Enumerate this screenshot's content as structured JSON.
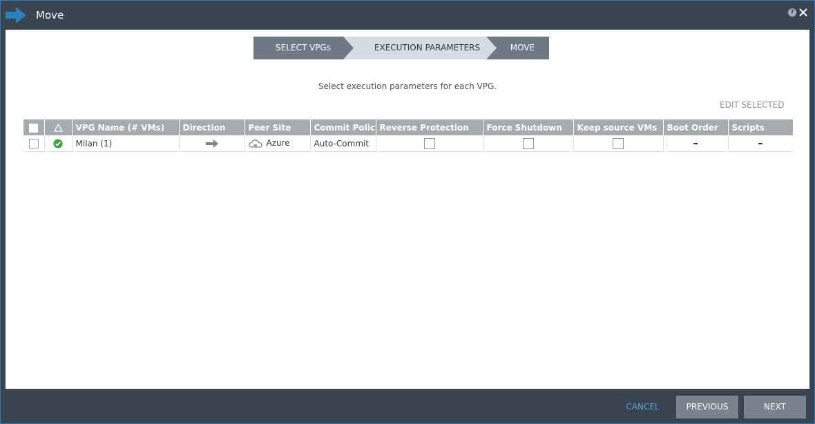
{
  "window": {
    "title": "Move",
    "icons": {
      "app": "move-arrow-icon",
      "help": "help-icon",
      "close": "close-icon"
    },
    "help_glyph": "?"
  },
  "wizard": {
    "steps": [
      {
        "label": "SELECT VPGs",
        "state": "done"
      },
      {
        "label": "EXECUTION PARAMETERS",
        "state": "active"
      },
      {
        "label": "MOVE",
        "state": "pending"
      }
    ]
  },
  "instruction": "Select execution parameters for each VPG.",
  "edit_selected_label": "EDIT SELECTED",
  "table": {
    "headers": {
      "select": "",
      "alert": "alert-triangle-icon",
      "vpg_name": "VPG Name (# VMs)",
      "direction": "Direction",
      "peer_site": "Peer Site",
      "commit_policy": "Commit Policy",
      "reverse_protection": "Reverse Protection",
      "force_shutdown": "Force Shutdown",
      "keep_source_vms": "Keep source VMs",
      "boot_order": "Boot Order",
      "scripts": "Scripts"
    },
    "rows": [
      {
        "selected": false,
        "status": "ok",
        "vpg_name": "Milan (1)",
        "direction": "arrow-right-icon",
        "peer_site_icon": "cloud-icon",
        "peer_site": "Azure",
        "commit_policy": "Auto-Commit",
        "reverse_protection": false,
        "force_shutdown": false,
        "keep_source_vms": false,
        "boot_order": "-",
        "scripts": "-"
      }
    ]
  },
  "footer": {
    "cancel": "CANCEL",
    "previous": "PREVIOUS",
    "next": "NEXT"
  },
  "colors": {
    "titlebar": "#3a4350",
    "accent": "#2b81c0",
    "wizard_active": "#d5dde3",
    "wizard_inactive": "#6f7885",
    "table_header": "#a6abb2",
    "status_ok": "#3aa33a",
    "cancel_text": "#5da1d8"
  }
}
